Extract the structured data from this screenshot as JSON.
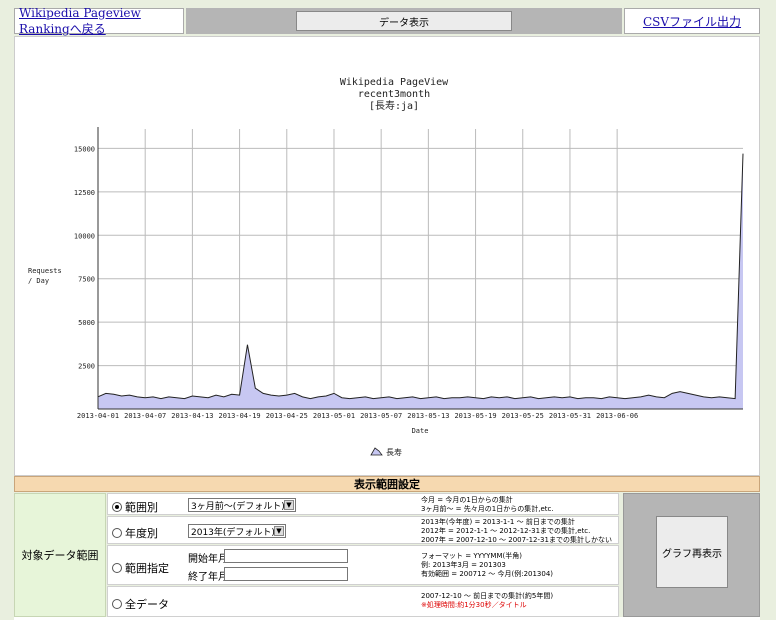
{
  "topbar": {
    "back_link": "Wikipedia Pageview Rankingへ戻る",
    "data_button": "データ表示",
    "csv_link": "CSVファイル出力"
  },
  "chart_data": {
    "type": "area",
    "title": [
      "Wikipedia PageView",
      "recent3month",
      "[長寿:ja]"
    ],
    "xlabel": "Date",
    "ylabel": [
      "Requests",
      "/ Day"
    ],
    "ylim": [
      0,
      16000
    ],
    "yticks": [
      2500,
      5000,
      7500,
      10000,
      12500,
      15000
    ],
    "xticks": [
      "2013-04-01",
      "2013-04-07",
      "2013-04-13",
      "2013-04-19",
      "2013-04-25",
      "2013-05-01",
      "2013-05-07",
      "2013-05-13",
      "2013-05-19",
      "2013-05-25",
      "2013-05-31",
      "2013-06-06"
    ],
    "grid": true,
    "legend_position": "bottom",
    "colors": {
      "fill": "#c7c7f2",
      "line": "#222222"
    },
    "series": [
      {
        "name": "長寿",
        "values": [
          700,
          900,
          850,
          750,
          800,
          700,
          650,
          700,
          600,
          700,
          650,
          600,
          750,
          700,
          650,
          800,
          700,
          850,
          800,
          3700,
          1200,
          900,
          800,
          750,
          800,
          900,
          700,
          600,
          700,
          750,
          900,
          650,
          600,
          650,
          700,
          600,
          650,
          700,
          600,
          650,
          700,
          600,
          650,
          700,
          600,
          650,
          650,
          700,
          650,
          600,
          700,
          650,
          700,
          600,
          650,
          700,
          600,
          650,
          700,
          650,
          700,
          600,
          650,
          650,
          600,
          700,
          650,
          600,
          650,
          700,
          800,
          700,
          650,
          900,
          1000,
          900,
          800,
          700,
          650,
          700,
          650,
          600,
          14700
        ]
      }
    ]
  },
  "settings": {
    "title": "表示範囲設定",
    "target_label": "対象データ範囲",
    "options": [
      {
        "label": "範囲別",
        "selected": true,
        "select_value": "3ヶ月前〜(デフォルト)",
        "desc": [
          "今月 = 今月の1日からの集計",
          "3ヶ月前〜 = 先々月の1日からの集計,etc."
        ]
      },
      {
        "label": "年度別",
        "selected": false,
        "select_value": "2013年(デフォルト)",
        "desc": [
          "2013年(今年度) = 2013-1-1 〜 前日までの集計",
          "2012年 = 2012-1-1 〜 2012-12-31までの集計,etc.",
          "2007年 = 2007-12-10 〜 2007-12-31までの集計しかない"
        ]
      },
      {
        "label": "範囲指定",
        "selected": false,
        "start_label": "開始年月",
        "end_label": "終了年月",
        "start_value": "",
        "end_value": "",
        "desc": [
          "フォーマット = YYYYMM(半角)",
          "例: 2013年3月 = 201303",
          "有効範囲 = 200712 〜 今月(例:201304)"
        ]
      },
      {
        "label": "全データ",
        "selected": false,
        "desc": [
          "2007-12-10 〜 前日までの集計(約5年間)"
        ],
        "desc_red": "※処理時間:約1分30秒／タイトル"
      }
    ],
    "redraw_button": "グラフ再表示"
  }
}
